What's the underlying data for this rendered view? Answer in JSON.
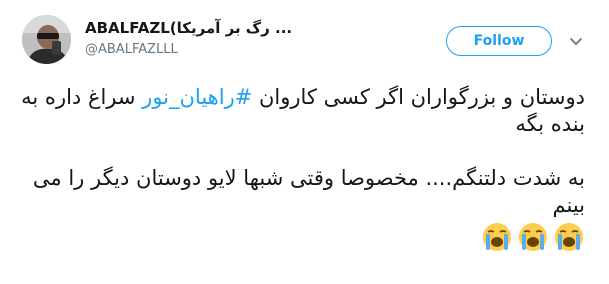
{
  "tweet": {
    "display_name": "ABALFAZL(",
    "display_name_rtl": "... رگ بر آمریکا",
    "handle": "@ABALFAZLLL",
    "follow_label": "Follow",
    "paragraph1_part1": "دوستان و بزرگواران اگر کسی کاروان ",
    "hashtag": "#راهیان_نور",
    "paragraph1_part2": " سراغ داره به بنده بگه",
    "paragraph2": "به شدت دلتنگم.... مخصوصا وقتی شبها لایو دوستان دیگر را می بینم",
    "emojis": [
      "loudly-crying-face-icon",
      "loudly-crying-face-icon",
      "loudly-crying-face-icon"
    ]
  },
  "colors": {
    "accent": "#1da1f2",
    "text": "#14171a",
    "secondary": "#657786"
  }
}
